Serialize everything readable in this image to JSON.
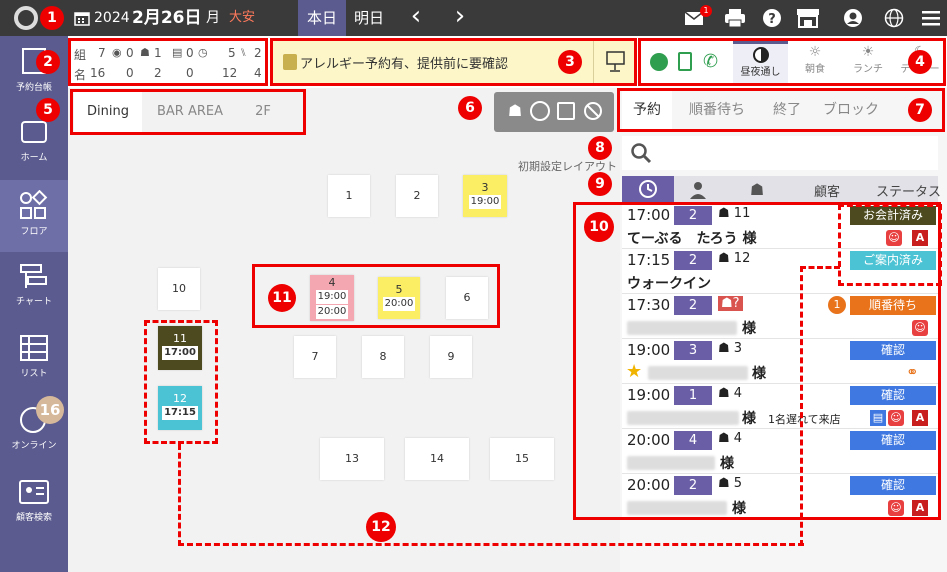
{
  "topbar": {
    "year": "2024",
    "date": "2月26日",
    "weekday": "月",
    "rokuyo": "大安",
    "today": "本日",
    "tomorrow": "明日",
    "prev": "‹",
    "next": "›",
    "mail_badge": "1"
  },
  "sidebar": {
    "items": [
      {
        "label": "予約台帳"
      },
      {
        "label": "ホーム"
      },
      {
        "label": "フロア"
      },
      {
        "label": "チャート"
      },
      {
        "label": "リスト"
      },
      {
        "label": "オンライン",
        "badge": "16"
      },
      {
        "label": "顧客検索"
      }
    ]
  },
  "stats": {
    "row1_label": "組",
    "row2_label": "名",
    "row1": [
      "7",
      "0",
      "1",
      "0",
      "5",
      "2"
    ],
    "row2": [
      "16",
      "0",
      "2",
      "0",
      "12",
      "4"
    ]
  },
  "alert": {
    "text": "アレルギー予約有、提供前に要確認"
  },
  "modes": {
    "items": [
      {
        "label": "昼夜通し"
      },
      {
        "label": "朝食"
      },
      {
        "label": "ランチ"
      },
      {
        "label": "ディナー"
      }
    ]
  },
  "floor": {
    "tabs": [
      {
        "label": "Dining"
      },
      {
        "label": "BAR AREA"
      },
      {
        "label": "2F"
      }
    ],
    "layout_label": "初期設定レイアウト",
    "tables": [
      {
        "no": "1",
        "time1": "",
        "time2": ""
      },
      {
        "no": "2",
        "time1": "",
        "time2": ""
      },
      {
        "no": "3",
        "time1": "19:00",
        "time2": ""
      },
      {
        "no": "10",
        "time1": "",
        "time2": ""
      },
      {
        "no": "4",
        "time1": "19:00",
        "time2": "20:00"
      },
      {
        "no": "5",
        "time1": "20:00",
        "time2": ""
      },
      {
        "no": "6",
        "time1": "",
        "time2": ""
      },
      {
        "no": "11",
        "time1": "17:00",
        "time2": ""
      },
      {
        "no": "7",
        "time1": "",
        "time2": ""
      },
      {
        "no": "8",
        "time1": "",
        "time2": ""
      },
      {
        "no": "9",
        "time1": "",
        "time2": ""
      },
      {
        "no": "12",
        "time1": "17:15",
        "time2": ""
      },
      {
        "no": "13",
        "time1": "",
        "time2": ""
      },
      {
        "no": "14",
        "time1": "",
        "time2": ""
      },
      {
        "no": "15",
        "time1": "",
        "time2": ""
      }
    ]
  },
  "list": {
    "tabs": [
      {
        "label": "予約"
      },
      {
        "label": "順番待ち"
      },
      {
        "label": "終了"
      },
      {
        "label": "ブロック"
      }
    ],
    "headers": {
      "customer": "顧客",
      "status": "ステータス"
    },
    "rows": [
      {
        "time": "17:00",
        "people": "2",
        "table": "11",
        "name": "てーぶる　たろう 様",
        "status": "お会計済み",
        "note": ""
      },
      {
        "time": "17:15",
        "people": "2",
        "table": "12",
        "name": "ウォークイン",
        "status": "ご案内済み",
        "note": ""
      },
      {
        "time": "17:30",
        "people": "2",
        "table": "?",
        "name": "様",
        "status": "順番待ち",
        "queue": "1",
        "note": ""
      },
      {
        "time": "19:00",
        "people": "3",
        "table": "3",
        "name": "様",
        "status": "確認",
        "note": ""
      },
      {
        "time": "19:00",
        "people": "1",
        "table": "4",
        "name": "様",
        "status": "確認",
        "note": "1名遅れて来店"
      },
      {
        "time": "20:00",
        "people": "4",
        "table": "4",
        "name": "様",
        "status": "確認",
        "note": ""
      },
      {
        "time": "20:00",
        "people": "2",
        "table": "5",
        "name": "様",
        "status": "確認",
        "note": ""
      }
    ]
  },
  "callouts": [
    "1",
    "2",
    "3",
    "4",
    "5",
    "6",
    "7",
    "8",
    "9",
    "10",
    "11",
    "12"
  ],
  "colors": {
    "topbar": "#3a3a3a",
    "sidebar": "#5b5b8f",
    "accent_purple": "#6a5fa7",
    "callout_red": "#e00000",
    "status_paid": "#4c4a1e",
    "status_seated": "#4cc3d4",
    "status_waiting": "#e8731b",
    "status_confirm": "#3f78e0"
  }
}
